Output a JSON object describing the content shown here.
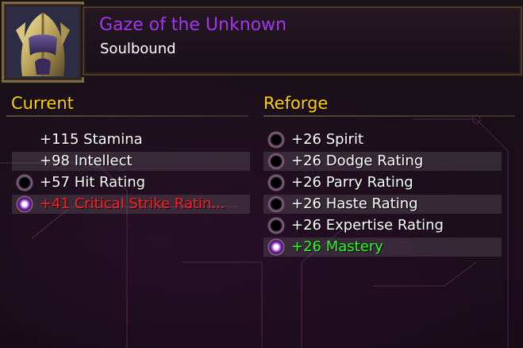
{
  "item": {
    "name": "Gaze of the Unknown",
    "binding": "Soulbound",
    "quality_color": "#a335ee",
    "icon": "golden-helm-icon"
  },
  "current": {
    "title": "Current",
    "stats": [
      {
        "text": "+115 Stamina",
        "radio": "none",
        "color": "#ffffff"
      },
      {
        "text": "+98 Intellect",
        "radio": "none",
        "color": "#ffffff"
      },
      {
        "text": "+57 Hit Rating",
        "radio": "unselected",
        "color": "#ffffff"
      },
      {
        "text": "+41 Critical Strike Ratin...",
        "radio": "selected",
        "color": "#ff2020"
      }
    ]
  },
  "reforge": {
    "title": "Reforge",
    "options": [
      {
        "text": "+26 Spirit",
        "selected": false
      },
      {
        "text": "+26 Dodge Rating",
        "selected": false
      },
      {
        "text": "+26 Parry Rating",
        "selected": false
      },
      {
        "text": "+26 Haste Rating",
        "selected": false
      },
      {
        "text": "+26 Expertise Rating",
        "selected": false
      },
      {
        "text": "+26 Mastery",
        "selected": true
      }
    ]
  },
  "colors": {
    "heading": "#ffd100",
    "removed_stat": "#ff2020",
    "added_stat": "#20ff20"
  }
}
